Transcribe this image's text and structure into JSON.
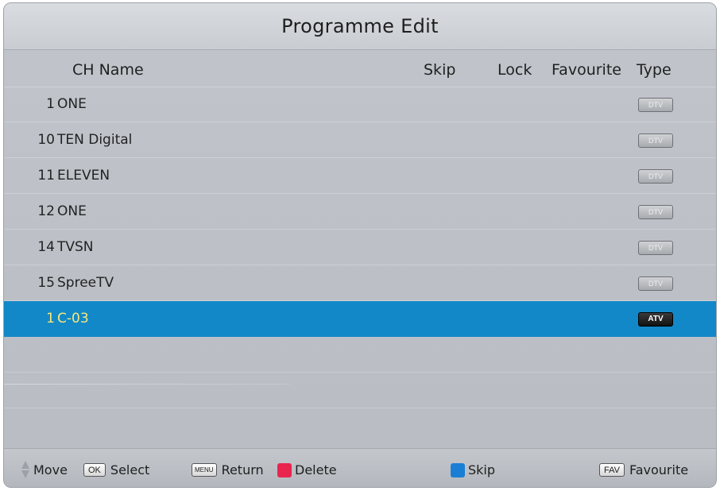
{
  "title": "Programme Edit",
  "columns": {
    "name": "CH Name",
    "skip": "Skip",
    "lock": "Lock",
    "favourite": "Favourite",
    "type": "Type"
  },
  "channels": [
    {
      "num": "1",
      "name": "ONE",
      "type": "DTV",
      "selected": false
    },
    {
      "num": "10",
      "name": "TEN Digital",
      "type": "DTV",
      "selected": false
    },
    {
      "num": "11",
      "name": "ELEVEN",
      "type": "DTV",
      "selected": false
    },
    {
      "num": "12",
      "name": "ONE",
      "type": "DTV",
      "selected": false
    },
    {
      "num": "14",
      "name": "TVSN",
      "type": "DTV",
      "selected": false
    },
    {
      "num": "15",
      "name": "SpreeTV",
      "type": "DTV",
      "selected": false
    },
    {
      "num": "1",
      "name": "C-03",
      "type": "ATV",
      "selected": true
    }
  ],
  "footer": {
    "move": "Move",
    "ok_key": "OK",
    "select": "Select",
    "menu_key": "MENU",
    "return": "Return",
    "delete": "Delete",
    "skip": "Skip",
    "fav_key": "FAV",
    "favourite": "Favourite"
  },
  "colors": {
    "selected_row": "#1288c8",
    "selected_text": "#f7e77c",
    "delete_key": "#e8254f",
    "skip_key": "#1a7fd4"
  }
}
